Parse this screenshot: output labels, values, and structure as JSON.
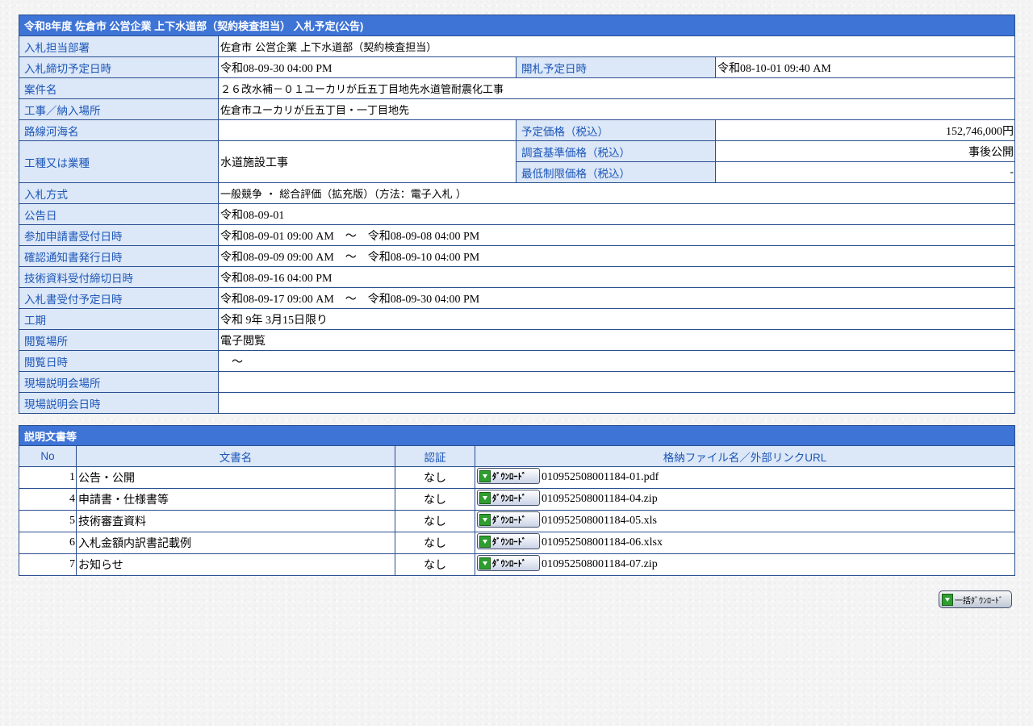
{
  "info": {
    "caption": "令和8年度 佐倉市 公営企業 上下水道部（契約検査担当） 入札予定(公告)",
    "dept_label": "入札担当部署",
    "dept_value": "佐倉市 公営企業 上下水道部（契約検査担当）",
    "deadline_label": "入札締切予定日時",
    "deadline_value": "令和08-09-30 04:00 PM",
    "opening_label": "開札予定日時",
    "opening_value": "令和08-10-01 09:40 AM",
    "project_label": "案件名",
    "project_value": "２６改水補－０１ユーカリが丘五丁目地先水道管耐震化工事",
    "location_label": "工事／納入場所",
    "location_value": "佐倉市ユーカリが丘五丁目・一丁目地先",
    "route_label": "路線河海名",
    "route_value": "",
    "planned_price_label": "予定価格（税込）",
    "planned_price_value": "152,746,000円",
    "category_label": "工種又は業種",
    "category_value": "水道施設工事",
    "survey_price_label": "調査基準価格（税込）",
    "survey_price_value": "事後公開",
    "min_price_label": "最低制限価格（税込）",
    "min_price_value": "-",
    "method_label": "入札方式",
    "method_value": "一般競争 ・ 総合評価（拡充版）（方法：電子入札 ）",
    "notice_date_label": "公告日",
    "notice_date_value": "令和08-09-01",
    "application_label": "参加申請書受付日時",
    "application_value": "令和08-09-01 09:00 AM　～　令和08-09-08 04:00 PM",
    "confirmation_label": "確認通知書発行日時",
    "confirmation_value": "令和08-09-09 09:00 AM　～　令和08-09-10 04:00 PM",
    "tech_doc_label": "技術資料受付締切日時",
    "tech_doc_value": "令和08-09-16 04:00 PM",
    "bid_receipt_label": "入札書受付予定日時",
    "bid_receipt_value": "令和08-09-17 09:00 AM　～　令和08-09-30 04:00 PM",
    "period_label": "工期",
    "period_value": "令和 9年 3月15日限り",
    "viewing_place_label": "閲覧場所",
    "viewing_place_value": "電子閲覧",
    "viewing_date_label": "閲覧日時",
    "viewing_date_value": "　～",
    "site_place_label": "現場説明会場所",
    "site_place_value": "",
    "site_date_label": "現場説明会日時",
    "site_date_value": ""
  },
  "documents": {
    "caption": "説明文書等",
    "headers": {
      "no": "No",
      "name": "文書名",
      "auth": "認証",
      "file": "格納ファイル名／外部リンクURL"
    },
    "download_label": "ﾀﾞｳﾝﾛｰﾄﾞ",
    "rows": [
      {
        "no": "1",
        "name": "公告・公開",
        "auth": "なし",
        "file": "010952508001184-01.pdf"
      },
      {
        "no": "4",
        "name": "申請書・仕様書等",
        "auth": "なし",
        "file": "010952508001184-04.zip"
      },
      {
        "no": "5",
        "name": "技術審査資料",
        "auth": "なし",
        "file": "010952508001184-05.xls"
      },
      {
        "no": "6",
        "name": "入札金額内訳書記載例",
        "auth": "なし",
        "file": "010952508001184-06.xlsx"
      },
      {
        "no": "7",
        "name": "お知らせ",
        "auth": "なし",
        "file": "010952508001184-07.zip"
      }
    ]
  },
  "bulk_download_label": "一括ﾀﾞｳﾝﾛｰﾄﾞ",
  "icons": {
    "download": "download-arrow-icon",
    "bulk_download": "bulk-download-icon"
  },
  "colors": {
    "caption_bg": "#3e74d6",
    "label_bg": "#dce7f7",
    "label_text": "#1b56b8",
    "border": "#2a4f8f"
  }
}
